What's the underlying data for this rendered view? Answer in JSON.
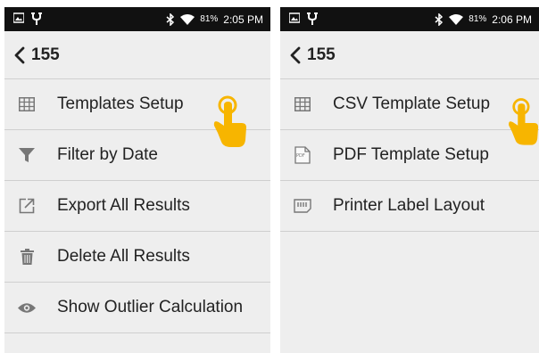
{
  "screens": [
    {
      "status": {
        "battery": "81%",
        "time": "2:05 PM"
      },
      "back_title": "155",
      "items": [
        {
          "label": "Templates Setup",
          "icon": "grid-icon"
        },
        {
          "label": "Filter by Date",
          "icon": "funnel-icon"
        },
        {
          "label": "Export All Results",
          "icon": "export-icon"
        },
        {
          "label": "Delete All Results",
          "icon": "trash-icon"
        },
        {
          "label": "Show Outlier Calculation",
          "icon": "eye-icon"
        }
      ]
    },
    {
      "status": {
        "battery": "81%",
        "time": "2:06 PM"
      },
      "back_title": "155",
      "items": [
        {
          "label": "CSV Template Setup",
          "icon": "grid-icon"
        },
        {
          "label": "PDF Template Setup",
          "icon": "pdf-file-icon",
          "badge": "PDF"
        },
        {
          "label": "Printer Label Layout",
          "icon": "label-icon"
        }
      ]
    }
  ],
  "colors": {
    "statusbar": "#111111",
    "background": "#eeeeee",
    "hand": "#f7b500",
    "divider": "#cfcfcf"
  }
}
